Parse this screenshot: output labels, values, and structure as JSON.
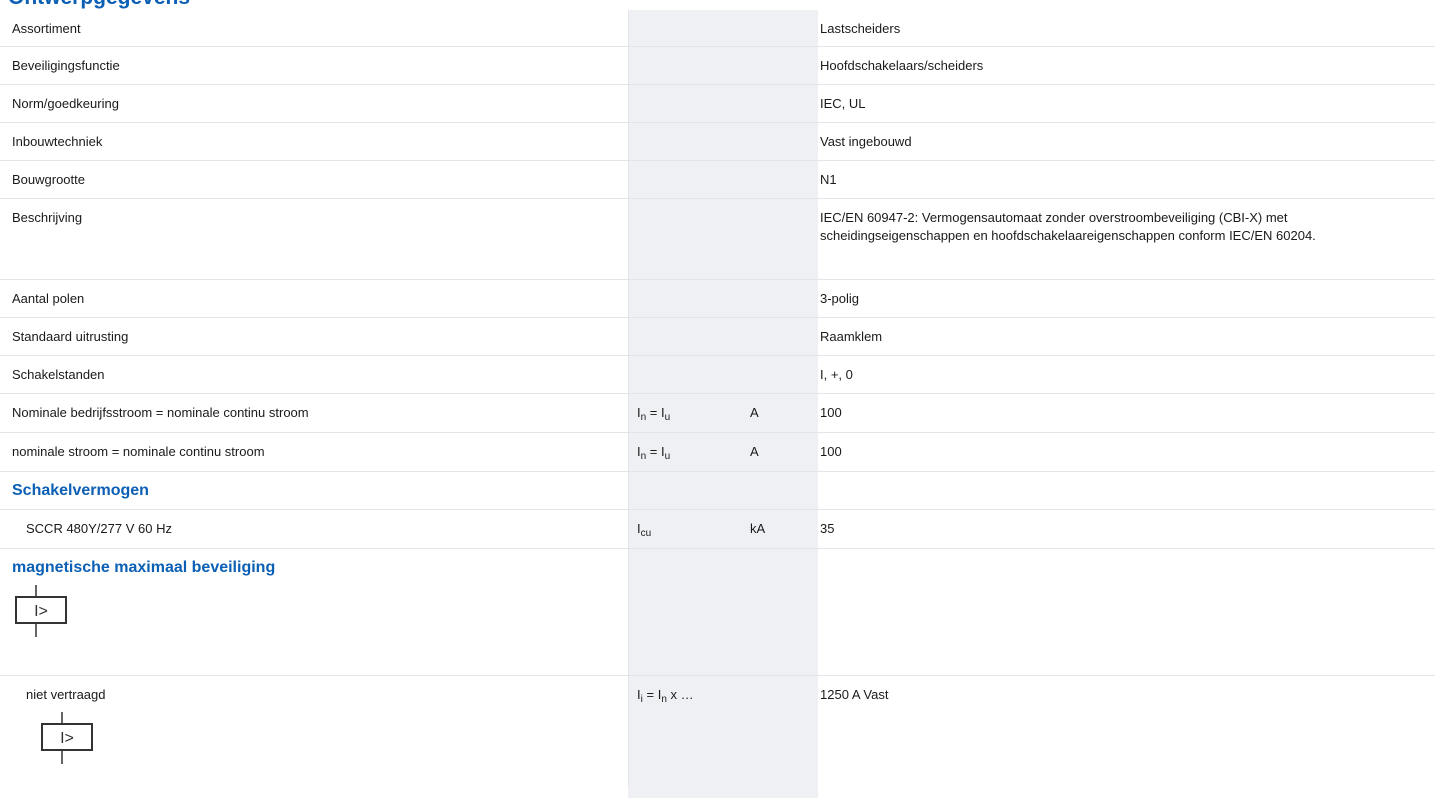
{
  "header_partial": "Ontwerpgegevens",
  "rows": [
    {
      "label": "Assortiment",
      "value": "Lastscheiders"
    },
    {
      "label": "Beveiligingsfunctie",
      "value": "Hoofdschakelaars/scheiders"
    },
    {
      "label": "Norm/goedkeuring",
      "value": "IEC, UL"
    },
    {
      "label": "Inbouwtechniek",
      "value": "Vast ingebouwd"
    },
    {
      "label": "Bouwgrootte",
      "value": "N1"
    },
    {
      "label": "Beschrijving",
      "value": "IEC/EN 60947-2: Vermogensautomaat zonder overstroombeveiliging (CBI-X) met scheidingseigenschappen en hoofdschakelaareigenschappen conform IEC/EN 60204."
    },
    {
      "label": "Aantal polen",
      "value": "3-polig"
    },
    {
      "label": "Standaard uitrusting",
      "value": "Raamklem"
    },
    {
      "label": "Schakelstanden",
      "value": "I, +, 0"
    }
  ],
  "rated_current": {
    "label": "Nominale bedrijfsstroom = nominale continu stroom",
    "sym_a": "I",
    "sub_a": "n",
    "eq": " = ",
    "sym_b": "I",
    "sub_b": "u",
    "unit": "A",
    "value": "100"
  },
  "nominal_current": {
    "label": "nominale stroom = nominale continu stroom",
    "sym_a": "I",
    "sub_a": "n",
    "eq": " = ",
    "sym_b": "I",
    "sub_b": "u",
    "unit": "A",
    "value": "100"
  },
  "section_switching": "Schakelvermogen",
  "sccr": {
    "label": "SCCR 480Y/277 V 60 Hz",
    "sym": "I",
    "sub": "cu",
    "unit": "kA",
    "value": "35"
  },
  "section_magnetic": "magnetische maximaal beveiliging",
  "symbol_glyph": "I>",
  "not_delayed": {
    "label": "niet vertraagd",
    "sym_a": "I",
    "sub_a": "i",
    "eq": " = ",
    "sym_b": "I",
    "sub_b": "n",
    "tail": " x …",
    "value": "1250 A Vast"
  }
}
